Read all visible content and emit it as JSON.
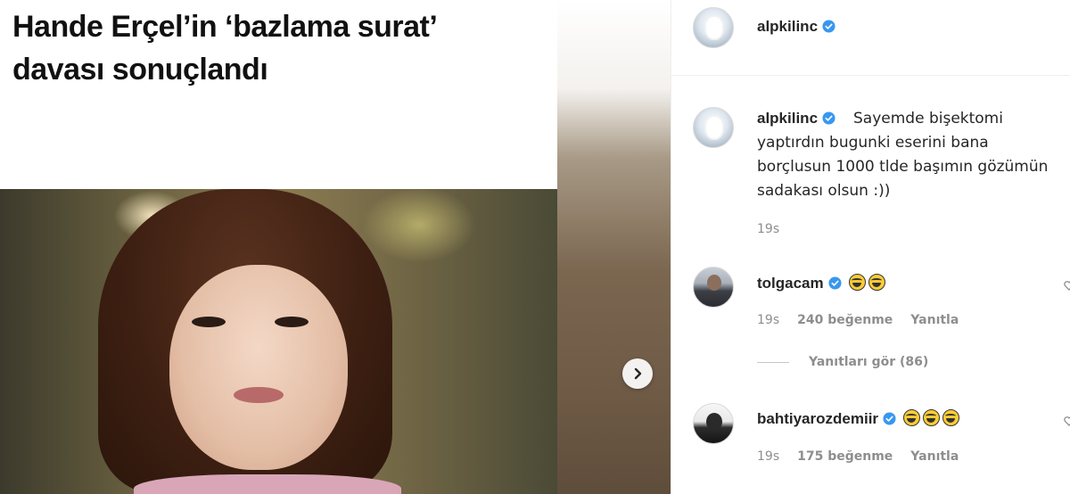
{
  "post": {
    "headline_line1": "Hande Erçel’in ‘bazlama surat’",
    "headline_line2": "davası sonuçlandı",
    "next_icon": "chevron-right-icon"
  },
  "header": {
    "username": "alpkilinc",
    "verified_icon": "verified-badge-icon"
  },
  "caption": {
    "username": "alpkilinc",
    "lines": [
      "Sayemde bişektomi",
      "yaptırdın bugunki eserini bana",
      "borçlusun 1000 tlde başımın gözümün",
      "sadakası olsun :))"
    ],
    "time": "19s"
  },
  "comments": [
    {
      "username": "tolgacam",
      "emoji_count": 2,
      "emoji_name": "face-with-tears-of-joy",
      "time": "19s",
      "likes": "240 beğenme",
      "reply_label": "Yanıtla"
    },
    {
      "username": "bahtiyarozdemiir",
      "emoji_count": 3,
      "emoji_name": "face-with-tears-of-joy",
      "time": "19s",
      "likes": "175 beğenme",
      "reply_label": "Yanıtla"
    }
  ],
  "view_replies": "Yanıtları gör (86)",
  "colors": {
    "verified_blue": "#3897f0",
    "meta_gray": "#8e8e8e",
    "text_dark": "#262626"
  }
}
